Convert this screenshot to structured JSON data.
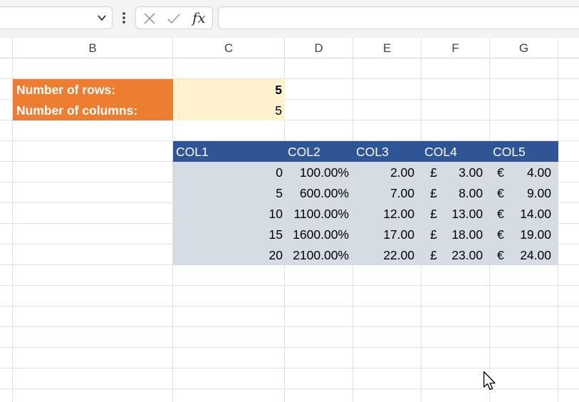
{
  "columns": [
    "B",
    "C",
    "D",
    "E",
    "F",
    "G"
  ],
  "inputs": {
    "rows_label": "Number of rows:",
    "rows_value": "5",
    "cols_label": "Number of columns:",
    "cols_value": "5"
  },
  "table": {
    "headers": [
      "COL1",
      "COL2",
      "COL3",
      "COL4",
      "COL5"
    ],
    "rows": [
      {
        "col1": "0",
        "col2": "100.00%",
        "col3": "2.00",
        "col4_sym": "£",
        "col4": "3.00",
        "col5_sym": "€",
        "col5": "4.00"
      },
      {
        "col1": "5",
        "col2": "600.00%",
        "col3": "7.00",
        "col4_sym": "£",
        "col4": "8.00",
        "col5_sym": "€",
        "col5": "9.00"
      },
      {
        "col1": "10",
        "col2": "1100.00%",
        "col3": "12.00",
        "col4_sym": "£",
        "col4": "13.00",
        "col5_sym": "€",
        "col5": "14.00"
      },
      {
        "col1": "15",
        "col2": "1600.00%",
        "col3": "17.00",
        "col4_sym": "£",
        "col4": "18.00",
        "col5_sym": "€",
        "col5": "19.00"
      },
      {
        "col1": "20",
        "col2": "2100.00%",
        "col3": "22.00",
        "col4_sym": "£",
        "col4": "23.00",
        "col5_sym": "€",
        "col5": "24.00"
      }
    ]
  },
  "formula_bar": {
    "name_box": "",
    "formula": "",
    "fx_label": "fx",
    "icons": [
      "chevron-down-icon",
      "more-options-icon",
      "cancel-icon",
      "confirm-icon",
      "function-icon"
    ]
  },
  "colors": {
    "orange": "#ed7d31",
    "light_yellow": "#fff2cc",
    "table_header": "#2f5597",
    "table_body": "#d6dce4"
  }
}
